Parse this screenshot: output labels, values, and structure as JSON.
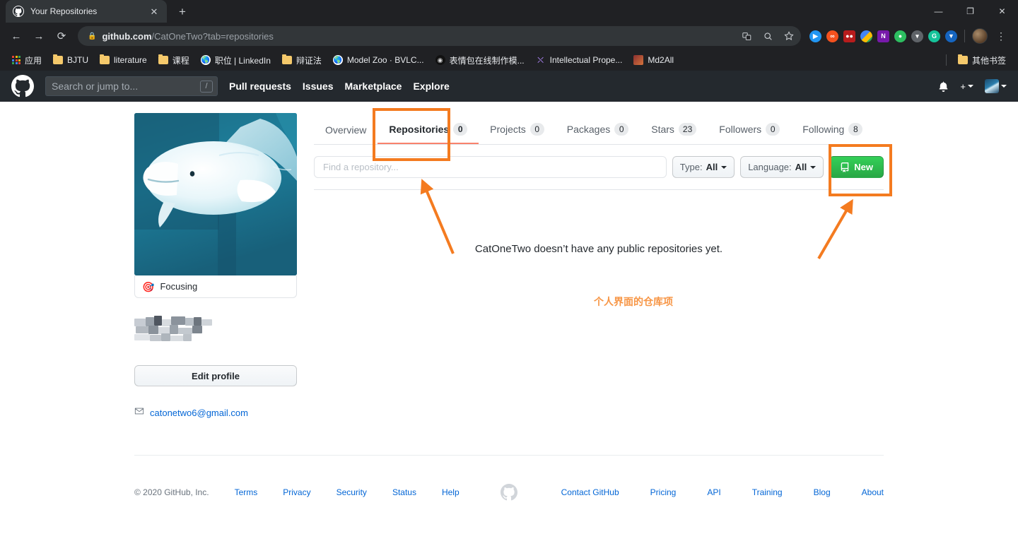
{
  "browser": {
    "tab": {
      "title": "Your Repositories",
      "favicon": "github-icon",
      "close": "✕"
    },
    "newtab_label": "+",
    "window_controls": {
      "minimize": "—",
      "maximize": "❐",
      "close": "✕"
    },
    "nav": {
      "back": "←",
      "forward": "→",
      "reload": "⟳"
    },
    "omnibox": {
      "lock_icon": "lock-icon",
      "url_domain": "github.com",
      "url_path": "/CatOneTwo?tab=repositories",
      "translate_icon": "translate-icon",
      "search_icon": "search-icon",
      "star_icon": "star-icon"
    },
    "extensions": [
      {
        "name": "pocket-blue-extension",
        "color": "#2196f3",
        "glyph": "▶",
        "shape": "circle"
      },
      {
        "name": "infinity-orange-extension",
        "color": "#f4511e",
        "glyph": "∞",
        "shape": "circle"
      },
      {
        "name": "red-square-extension",
        "color": "#b71c1c",
        "glyph": "••",
        "shape": "square"
      },
      {
        "name": "google-keep-extension",
        "color": "#fbbc04",
        "glyph": "",
        "shape": "keep"
      },
      {
        "name": "onenote-extension",
        "color": "#7719aa",
        "glyph": "N",
        "shape": "square"
      },
      {
        "name": "evernote-extension",
        "color": "#2dbe60",
        "glyph": "◉",
        "shape": "circle"
      },
      {
        "name": "pocket-shield-extension",
        "color": "#5f6368",
        "glyph": "▽",
        "shape": "circle"
      },
      {
        "name": "grammarly-extension",
        "color": "#15c39a",
        "glyph": "G",
        "shape": "circle"
      },
      {
        "name": "diamond-blue-extension",
        "color": "#1565c0",
        "glyph": "▼",
        "shape": "circle"
      }
    ],
    "profile_avatar": "browser-profile-avatar",
    "menu_icon": "kebab-menu-icon",
    "bookmarks": [
      {
        "label": "应用",
        "icon": "apps-grid-icon"
      },
      {
        "label": "BJTU",
        "icon": "folder-icon"
      },
      {
        "label": "literature",
        "icon": "folder-icon"
      },
      {
        "label": "课程",
        "icon": "folder-icon"
      },
      {
        "label": "职位 | LinkedIn",
        "icon": "globe-icon"
      },
      {
        "label": "辩证法",
        "icon": "folder-icon"
      },
      {
        "label": "Model Zoo · BVLC...",
        "icon": "globe-icon"
      },
      {
        "label": "表情包在线制作模...",
        "icon": "emoji-site-icon"
      },
      {
        "label": "Intellectual Prope...",
        "icon": "purple-site-icon"
      },
      {
        "label": "Md2All",
        "icon": "md2all-icon"
      }
    ],
    "other_bookmarks": {
      "label": "其他书签",
      "icon": "folder-icon"
    }
  },
  "github_header": {
    "logo": "github-mark-icon",
    "search_placeholder": "Search or jump to...",
    "search_shortcut": "/",
    "nav": [
      {
        "label": "Pull requests"
      },
      {
        "label": "Issues"
      },
      {
        "label": "Marketplace"
      },
      {
        "label": "Explore"
      }
    ],
    "notification_icon": "bell-icon",
    "create_new_label": "+",
    "user_avatar": "user-avatar"
  },
  "profile": {
    "avatar_alt": "beluga-whale-avatar",
    "status": {
      "emoji": "🎯",
      "text": "Focusing"
    },
    "name_blurred": true,
    "edit_profile_label": "Edit profile",
    "email": "catonetwo6@gmail.com",
    "email_icon": "mail-icon"
  },
  "tabs": [
    {
      "label": "Overview",
      "count": null,
      "selected": false
    },
    {
      "label": "Repositories",
      "count": "0",
      "selected": true
    },
    {
      "label": "Projects",
      "count": "0",
      "selected": false
    },
    {
      "label": "Packages",
      "count": "0",
      "selected": false
    },
    {
      "label": "Stars",
      "count": "23",
      "selected": false
    },
    {
      "label": "Followers",
      "count": "0",
      "selected": false
    },
    {
      "label": "Following",
      "count": "8",
      "selected": false
    }
  ],
  "filters": {
    "search_placeholder": "Find a repository...",
    "search_value": "",
    "type": {
      "label": "Type:",
      "value": "All"
    },
    "language": {
      "label": "Language:",
      "value": "All"
    },
    "new_button": {
      "label": "New",
      "icon": "repo-icon",
      "color": "#28a745"
    }
  },
  "empty_state": "CatOneTwo doesn’t have any public repositories yet.",
  "annotations": {
    "note_text": "个人界面的仓库项",
    "color": "#f47b20",
    "boxes": [
      {
        "name": "repositories-tab-highlight"
      },
      {
        "name": "new-button-highlight"
      }
    ],
    "arrows": [
      {
        "name": "arrow-to-repositories-tab"
      },
      {
        "name": "arrow-to-new-button"
      }
    ]
  },
  "footer": {
    "copyright": "© 2020 GitHub, Inc.",
    "left_links": [
      "Terms",
      "Privacy",
      "Security",
      "Status",
      "Help"
    ],
    "mark": "github-mark-icon",
    "right_links": [
      "Contact GitHub",
      "Pricing",
      "API",
      "Training",
      "Blog",
      "About"
    ]
  }
}
